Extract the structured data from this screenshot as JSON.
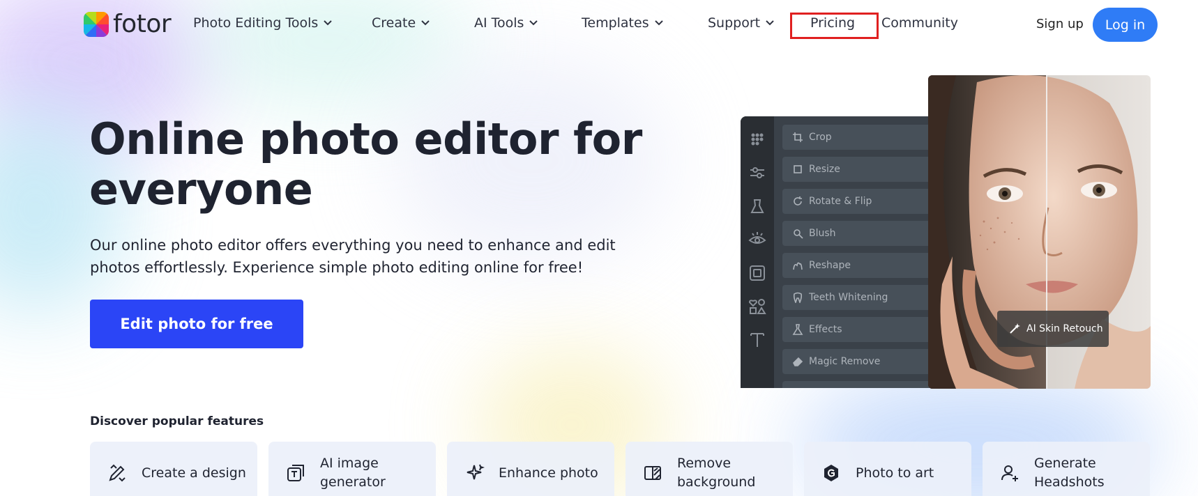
{
  "header": {
    "logo_text": "fotor",
    "nav": [
      {
        "label": "Photo Editing Tools",
        "has_dropdown": true
      },
      {
        "label": "Create",
        "has_dropdown": true
      },
      {
        "label": "AI Tools",
        "has_dropdown": true
      },
      {
        "label": "Templates",
        "has_dropdown": true
      },
      {
        "label": "Support",
        "has_dropdown": true
      },
      {
        "label": "Pricing",
        "has_dropdown": false,
        "highlighted": true
      },
      {
        "label": "Community",
        "has_dropdown": false
      }
    ],
    "signup_label": "Sign up",
    "login_label": "Log in"
  },
  "hero": {
    "title": "Online photo editor for everyone",
    "subtitle": "Our online photo editor offers everything you need to enhance and edit photos effortlessly. Experience simple photo editing online for free!",
    "cta_label": "Edit photo for free"
  },
  "editor_mockup": {
    "tools": [
      "Crop",
      "Resize",
      "Rotate & Flip",
      "Blush",
      "Reshape",
      "Teeth Whitening",
      "Effects",
      "Magic Remove"
    ],
    "badge_label": "AI Skin Retouch"
  },
  "features": {
    "heading": "Discover popular features",
    "items": [
      {
        "label": "Create a design",
        "icon": "pencil-ruler-icon"
      },
      {
        "label": "AI image generator",
        "icon": "ai-image-icon"
      },
      {
        "label": "Enhance photo",
        "icon": "sparkle-icon"
      },
      {
        "label": "Remove background",
        "icon": "remove-bg-icon"
      },
      {
        "label": "Photo to art",
        "icon": "art-icon"
      },
      {
        "label": "Generate Headshots",
        "icon": "user-plus-icon"
      }
    ]
  },
  "colors": {
    "accent": "#2f7cf6",
    "cta": "#2b45f6",
    "highlight_box": "#e02020"
  }
}
